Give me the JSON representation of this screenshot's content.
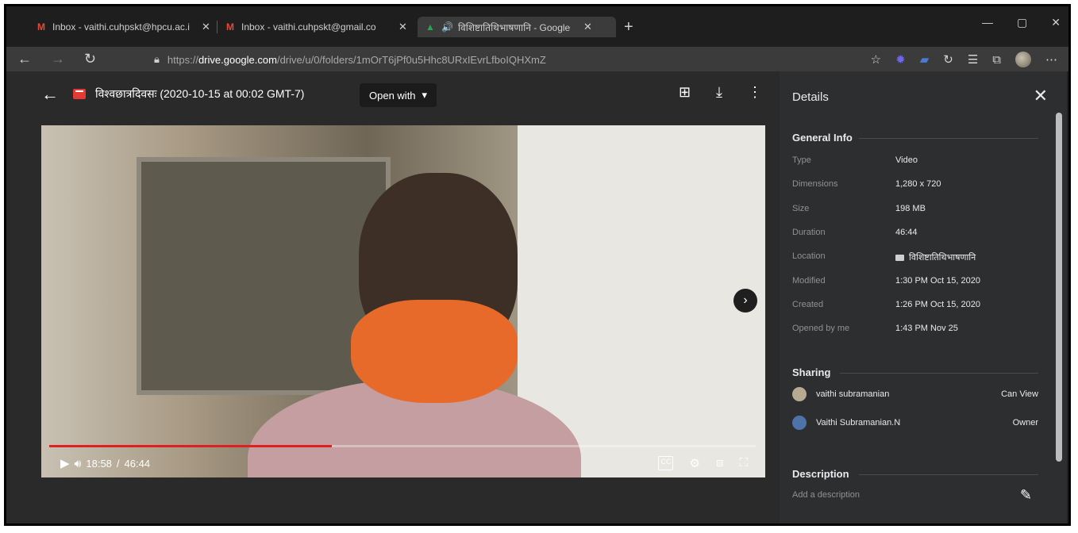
{
  "browser": {
    "tabs": [
      {
        "title": "Inbox - vaithi.cuhpskt@hpcu.ac.i",
        "icon": "gmail-icon"
      },
      {
        "title": "Inbox - vaithi.cuhpskt@gmail.co",
        "icon": "gmail-icon"
      },
      {
        "title": "विशिष्टातिथिभाषणानि - Google",
        "icon": "drive-icon"
      }
    ],
    "url_prefix": "https://",
    "url_domain": "drive.google.com",
    "url_path": "/drive/u/0/folders/1mOrT6jPf0u5Hhc8URxIEvrLfboIQHXmZ"
  },
  "viewer": {
    "filename": "विश्वछात्रदिवसः (2020-10-15 at 00:02 GMT-7)",
    "open_with": "Open with",
    "time_current": "18:58",
    "time_total": "46:44",
    "progress": 0.4,
    "cc_label": "CC"
  },
  "details": {
    "title": "Details",
    "general_title": "General Info",
    "info": [
      {
        "k": "Type",
        "v": "Video"
      },
      {
        "k": "Dimensions",
        "v": "1,280 x 720"
      },
      {
        "k": "Size",
        "v": "198 MB"
      },
      {
        "k": "Duration",
        "v": "46:44"
      },
      {
        "k": "Location",
        "v": "विशिष्टातिथिभाषणानि"
      },
      {
        "k": "Modified",
        "v": "1:30 PM Oct 15, 2020"
      },
      {
        "k": "Created",
        "v": "1:26 PM Oct 15, 2020"
      },
      {
        "k": "Opened by me",
        "v": "1:43 PM Nov 25"
      }
    ],
    "sharing_title": "Sharing",
    "sharing": [
      {
        "name": "vaithi subramanian",
        "perm": "Can View"
      },
      {
        "name": "Vaithi Subramanian.N",
        "perm": "Owner"
      }
    ],
    "description_title": "Description",
    "description_placeholder": "Add a description"
  }
}
